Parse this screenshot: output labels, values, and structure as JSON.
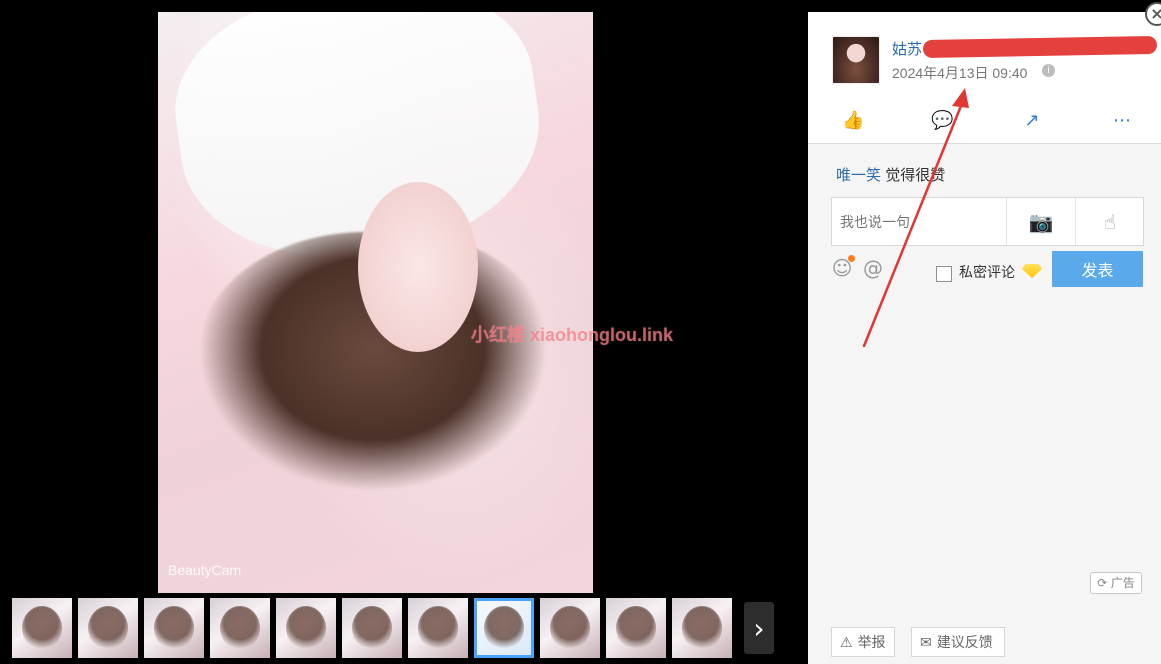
{
  "viewer": {
    "watermark_text": "小红楼 xiaohonglou.link",
    "camera_watermark": "BeautyCam",
    "thumbnails": [
      {
        "label": ""
      },
      {
        "label": ""
      },
      {
        "label": ""
      },
      {
        "label": ""
      },
      {
        "label": ""
      },
      {
        "label": ""
      },
      {
        "label": ""
      },
      {
        "label": "",
        "selected": true
      },
      {
        "label": ""
      },
      {
        "label": ""
      },
      {
        "label": ""
      }
    ],
    "next_icon": "chevron-right-icon"
  },
  "panel": {
    "user_name": "姑苏",
    "post_time": "2024年4月13日 09:40",
    "info_icon": "i",
    "actions": [
      {
        "name": "like",
        "icon": "👍"
      },
      {
        "name": "comment",
        "icon": "💬"
      },
      {
        "name": "share",
        "icon": "↗"
      },
      {
        "name": "more",
        "icon": "⋯"
      }
    ],
    "liked_by": {
      "name": "唯一笑",
      "text": "觉得很赞"
    },
    "comment": {
      "placeholder": "我也说一句",
      "camera_icon": "📷",
      "gesture_icon": "☝"
    },
    "emoji_icon": "☺",
    "mention_icon": "@",
    "private_label": "私密评论",
    "post_button": "发表",
    "ad_badge": "广告",
    "report_button": "举报",
    "feedback_button": "建议反馈",
    "close_icon": "×"
  },
  "colors": {
    "accent": "#5aa9ea",
    "link": "#2d6cad",
    "annotation_red": "#e23634"
  }
}
